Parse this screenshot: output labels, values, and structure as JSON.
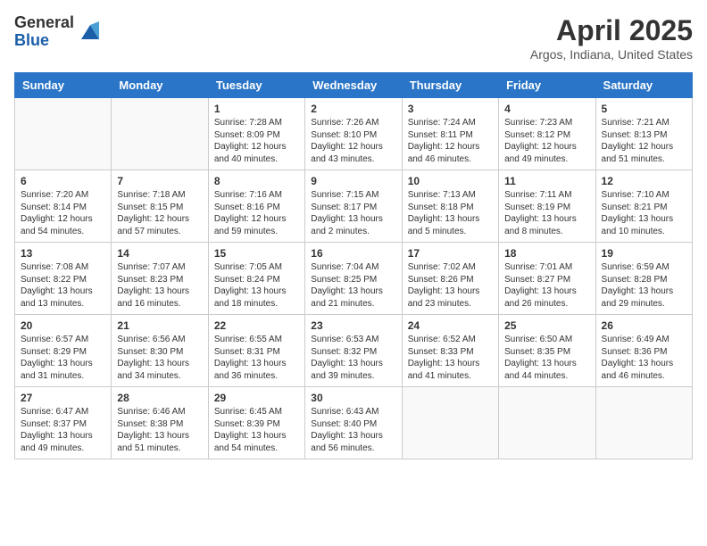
{
  "logo": {
    "general": "General",
    "blue": "Blue"
  },
  "header": {
    "month": "April 2025",
    "location": "Argos, Indiana, United States"
  },
  "weekdays": [
    "Sunday",
    "Monday",
    "Tuesday",
    "Wednesday",
    "Thursday",
    "Friday",
    "Saturday"
  ],
  "weeks": [
    [
      {
        "day": "",
        "info": ""
      },
      {
        "day": "",
        "info": ""
      },
      {
        "day": "1",
        "info": "Sunrise: 7:28 AM\nSunset: 8:09 PM\nDaylight: 12 hours and 40 minutes."
      },
      {
        "day": "2",
        "info": "Sunrise: 7:26 AM\nSunset: 8:10 PM\nDaylight: 12 hours and 43 minutes."
      },
      {
        "day": "3",
        "info": "Sunrise: 7:24 AM\nSunset: 8:11 PM\nDaylight: 12 hours and 46 minutes."
      },
      {
        "day": "4",
        "info": "Sunrise: 7:23 AM\nSunset: 8:12 PM\nDaylight: 12 hours and 49 minutes."
      },
      {
        "day": "5",
        "info": "Sunrise: 7:21 AM\nSunset: 8:13 PM\nDaylight: 12 hours and 51 minutes."
      }
    ],
    [
      {
        "day": "6",
        "info": "Sunrise: 7:20 AM\nSunset: 8:14 PM\nDaylight: 12 hours and 54 minutes."
      },
      {
        "day": "7",
        "info": "Sunrise: 7:18 AM\nSunset: 8:15 PM\nDaylight: 12 hours and 57 minutes."
      },
      {
        "day": "8",
        "info": "Sunrise: 7:16 AM\nSunset: 8:16 PM\nDaylight: 12 hours and 59 minutes."
      },
      {
        "day": "9",
        "info": "Sunrise: 7:15 AM\nSunset: 8:17 PM\nDaylight: 13 hours and 2 minutes."
      },
      {
        "day": "10",
        "info": "Sunrise: 7:13 AM\nSunset: 8:18 PM\nDaylight: 13 hours and 5 minutes."
      },
      {
        "day": "11",
        "info": "Sunrise: 7:11 AM\nSunset: 8:19 PM\nDaylight: 13 hours and 8 minutes."
      },
      {
        "day": "12",
        "info": "Sunrise: 7:10 AM\nSunset: 8:21 PM\nDaylight: 13 hours and 10 minutes."
      }
    ],
    [
      {
        "day": "13",
        "info": "Sunrise: 7:08 AM\nSunset: 8:22 PM\nDaylight: 13 hours and 13 minutes."
      },
      {
        "day": "14",
        "info": "Sunrise: 7:07 AM\nSunset: 8:23 PM\nDaylight: 13 hours and 16 minutes."
      },
      {
        "day": "15",
        "info": "Sunrise: 7:05 AM\nSunset: 8:24 PM\nDaylight: 13 hours and 18 minutes."
      },
      {
        "day": "16",
        "info": "Sunrise: 7:04 AM\nSunset: 8:25 PM\nDaylight: 13 hours and 21 minutes."
      },
      {
        "day": "17",
        "info": "Sunrise: 7:02 AM\nSunset: 8:26 PM\nDaylight: 13 hours and 23 minutes."
      },
      {
        "day": "18",
        "info": "Sunrise: 7:01 AM\nSunset: 8:27 PM\nDaylight: 13 hours and 26 minutes."
      },
      {
        "day": "19",
        "info": "Sunrise: 6:59 AM\nSunset: 8:28 PM\nDaylight: 13 hours and 29 minutes."
      }
    ],
    [
      {
        "day": "20",
        "info": "Sunrise: 6:57 AM\nSunset: 8:29 PM\nDaylight: 13 hours and 31 minutes."
      },
      {
        "day": "21",
        "info": "Sunrise: 6:56 AM\nSunset: 8:30 PM\nDaylight: 13 hours and 34 minutes."
      },
      {
        "day": "22",
        "info": "Sunrise: 6:55 AM\nSunset: 8:31 PM\nDaylight: 13 hours and 36 minutes."
      },
      {
        "day": "23",
        "info": "Sunrise: 6:53 AM\nSunset: 8:32 PM\nDaylight: 13 hours and 39 minutes."
      },
      {
        "day": "24",
        "info": "Sunrise: 6:52 AM\nSunset: 8:33 PM\nDaylight: 13 hours and 41 minutes."
      },
      {
        "day": "25",
        "info": "Sunrise: 6:50 AM\nSunset: 8:35 PM\nDaylight: 13 hours and 44 minutes."
      },
      {
        "day": "26",
        "info": "Sunrise: 6:49 AM\nSunset: 8:36 PM\nDaylight: 13 hours and 46 minutes."
      }
    ],
    [
      {
        "day": "27",
        "info": "Sunrise: 6:47 AM\nSunset: 8:37 PM\nDaylight: 13 hours and 49 minutes."
      },
      {
        "day": "28",
        "info": "Sunrise: 6:46 AM\nSunset: 8:38 PM\nDaylight: 13 hours and 51 minutes."
      },
      {
        "day": "29",
        "info": "Sunrise: 6:45 AM\nSunset: 8:39 PM\nDaylight: 13 hours and 54 minutes."
      },
      {
        "day": "30",
        "info": "Sunrise: 6:43 AM\nSunset: 8:40 PM\nDaylight: 13 hours and 56 minutes."
      },
      {
        "day": "",
        "info": ""
      },
      {
        "day": "",
        "info": ""
      },
      {
        "day": "",
        "info": ""
      }
    ]
  ]
}
